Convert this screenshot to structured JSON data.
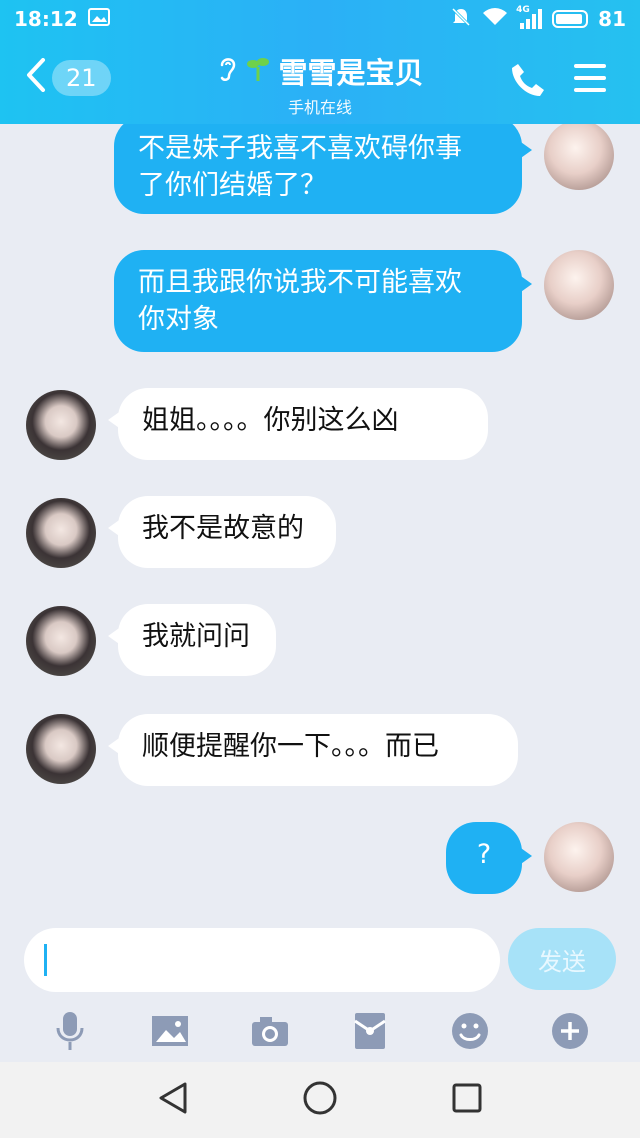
{
  "status_bar": {
    "time": "18:12",
    "network": "4G",
    "battery": "81"
  },
  "header": {
    "unread_count": "21",
    "contact_name": "雪雪是宝贝",
    "status": "手机在线"
  },
  "messages": [
    {
      "from": "me",
      "text": "不是妹子我喜不喜欢碍你事\n了你们结婚了？"
    },
    {
      "from": "me",
      "text": "而且我跟你说我不可能喜欢\n你对象"
    },
    {
      "from": "other",
      "text": "姐姐。。。。你别这么凶"
    },
    {
      "from": "other",
      "text": "我不是故意的"
    },
    {
      "from": "other",
      "text": "我就问问"
    },
    {
      "from": "other",
      "text": "顺便提醒你一下。。。而已"
    },
    {
      "from": "me",
      "text": "?"
    }
  ],
  "input": {
    "value": "",
    "send_label": "发送"
  },
  "toolbar": [
    "microphone-icon",
    "image-icon",
    "camera-icon",
    "red-packet-icon",
    "emoji-icon",
    "plus-icon"
  ],
  "colors": {
    "header": "#1ec3f2",
    "my_bubble": "#1fb1f3",
    "background": "#e9ecf3"
  }
}
